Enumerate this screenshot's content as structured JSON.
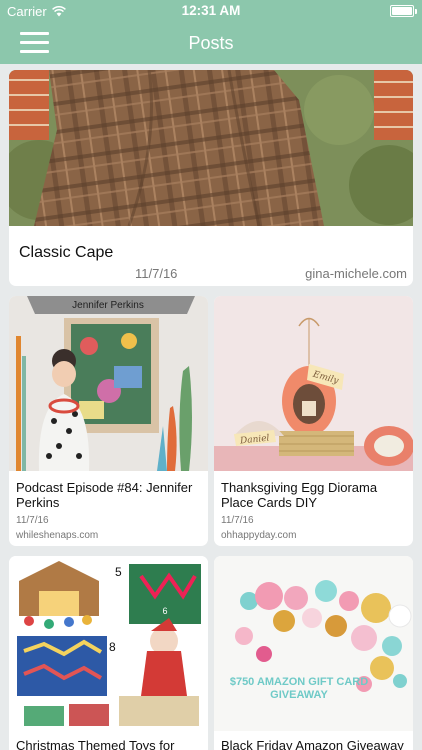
{
  "status_bar": {
    "carrier": "Carrier",
    "time": "12:31 AM"
  },
  "nav": {
    "title": "Posts",
    "menu_icon": "hamburger-menu-icon"
  },
  "posts": [
    {
      "title": "Classic Cape",
      "date": "11/7/16",
      "source": "gina-michele.com"
    },
    {
      "title": "Podcast Episode #84: Jennifer Perkins",
      "date": "11/7/16",
      "source": "whileshenaps.com",
      "image_caption": "Jennifer Perkins"
    },
    {
      "title": "Thanksgiving Egg Diorama Place Cards DIY",
      "date": "11/7/16",
      "source": "ohhappyday.com",
      "image_tags": [
        "Emily",
        "Daniel"
      ]
    },
    {
      "title": "Christmas Themed Toys for",
      "image_numbers": [
        "5",
        "6",
        "8"
      ]
    },
    {
      "title": "Black Friday Amazon Giveaway",
      "image_caption": "$750 AMAZON GIFT CARD GIVEAWAY"
    }
  ],
  "colors": {
    "header": "#8cc7ac",
    "background": "#e7eaeb",
    "card": "#ffffff"
  }
}
